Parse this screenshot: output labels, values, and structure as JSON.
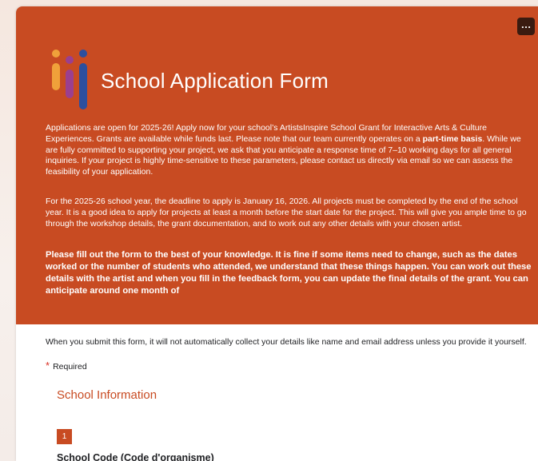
{
  "header": {
    "title": "School Application Form",
    "more_button": "…",
    "paragraph1_before": "Applications are open for 2025-26! Apply now for your school’s ArtistsInspire School Grant for Interactive Arts & Culture Experiences. Grants are available while funds last. Please note that our team currently operates on a ",
    "paragraph1_bold": "part-time basis",
    "paragraph1_after": ". While we are fully committed to supporting your project, we ask that you anticipate a response time of 7–10 working days for all general inquiries. If your project is highly time-sensitive to these parameters, please contact us directly via email so we can assess the feasibility of your application.",
    "paragraph2": "For the 2025-26 school year, the deadline to apply is January 16, 2026. All projects must be completed by the end of the school year. It is a good idea to apply for projects at least a month before the start date for the project. This will give you ample time to go through the workshop details, the grant documentation, and to work out any other details with your chosen artist.",
    "paragraph3": "Please fill out the form to the best of your knowledge. It is fine if some items need to change, such as the dates worked or the number of students who attended, we understand that these things happen. You can work out these details with the artist and when you fill in the feedback form, you can update the final details of the grant. You can anticipate around one month of"
  },
  "body": {
    "notice": "When you submit this form, it will not automatically collect your details like name and email address unless you provide it yourself.",
    "required_star": "*",
    "required_label": "Required",
    "section_title": "School Information",
    "question_number": "1",
    "question_title": "School Code (Code d'organisme)"
  },
  "colors": {
    "header_bg": "#c84b22",
    "accent": "#c84b22",
    "logo_orange": "#f0a13a",
    "logo_purple": "#9b3f8f",
    "logo_blue": "#2c4f9e"
  }
}
